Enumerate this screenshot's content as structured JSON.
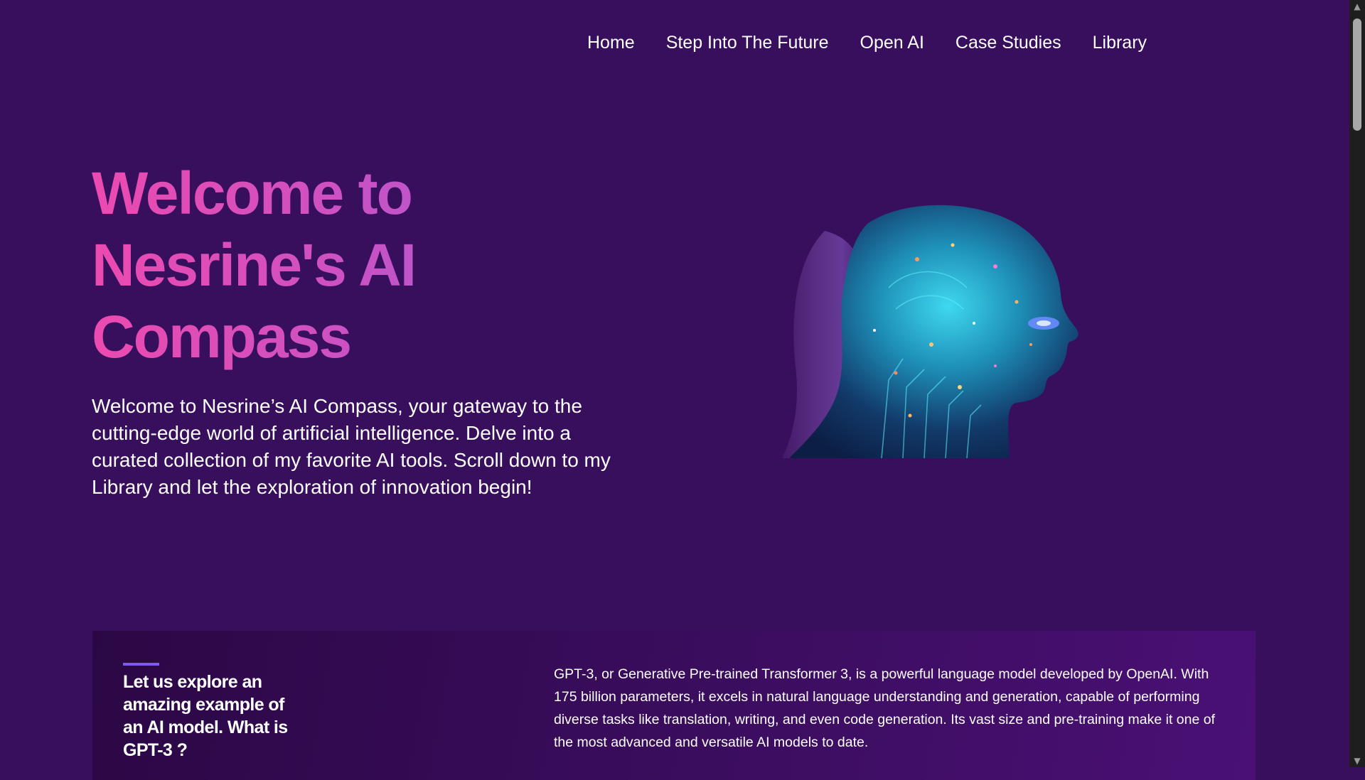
{
  "nav": {
    "items": [
      {
        "label": "Home"
      },
      {
        "label": "Step Into The Future"
      },
      {
        "label": "Open AI"
      },
      {
        "label": "Case Studies"
      },
      {
        "label": "Library"
      }
    ]
  },
  "hero": {
    "title_line1": "Welcome to",
    "title_line2": "Nesrine's AI",
    "title_line3": "Compass",
    "intro": "Welcome to Nesrine’s AI Compass, your gateway to the cutting-edge world of artificial intelligence. Delve into a curated collection of my favorite AI tools. Scroll down to my Library and let the exploration of innovation begin!",
    "image_icon": "ai-head-illustration"
  },
  "gpt_section": {
    "heading": "Let us explore an amazing example of an AI model. What is GPT-3 ?",
    "body": "GPT-3, or Generative Pre-trained Transformer 3, is a powerful language model developed by OpenAI. With 175 billion parameters, it excels in natural language understanding and generation, capable of performing diverse tasks like translation, writing, and even code generation. Its vast size and pre-training make it one of the most advanced and versatile AI models to date."
  },
  "colors": {
    "background": "#380f5c",
    "title_gradient_start": "#ec4ab0",
    "title_gradient_end": "#b257d0",
    "accent_bar": "#7c5cf0"
  }
}
